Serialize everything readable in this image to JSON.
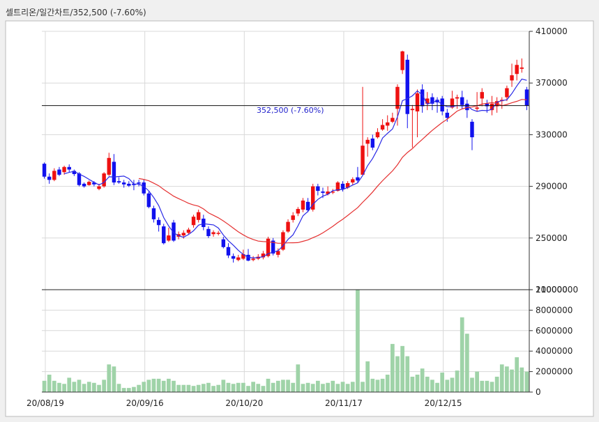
{
  "header": {
    "title": "셀트리온/일간차트/352,500  (-7.60%)"
  },
  "colors": {
    "up": "#ee1111",
    "down": "#1111ee",
    "ma_short": "#2a2ae6",
    "ma_long": "#e53030",
    "volume": "#9fd3a8",
    "grid": "#d8d8d8",
    "bg": "#ffffff"
  },
  "chart_data": [
    {
      "type": "candlestick",
      "title": "셀트리온/일간차트/352,500  (-7.60%)",
      "current_label": "352,500 (-7.60%)",
      "current_price": 352500,
      "ylim": [
        210000,
        410000
      ],
      "y_ticks": [
        "410000",
        "370000",
        "330000",
        "290000",
        "250000",
        "210000"
      ],
      "y_tick_values": [
        410000,
        370000,
        330000,
        290000,
        250000,
        210000
      ],
      "x_ticks": [
        "20/08/19",
        "20/09/16",
        "20/10/20",
        "20/11/17",
        "20/12/15"
      ],
      "x_tick_index": [
        0,
        20,
        40,
        60,
        80
      ],
      "grid": true,
      "candles": [
        [
          307500,
          297500,
          308500,
          296000
        ],
        [
          297500,
          295000,
          300000,
          292000
        ],
        [
          295000,
          302000,
          304000,
          294000
        ],
        [
          303000,
          299000,
          305000,
          298000
        ],
        [
          301000,
          305000,
          306000,
          299000
        ],
        [
          305000,
          303000,
          307000,
          301000
        ],
        [
          302000,
          299500,
          303000,
          298000
        ],
        [
          300000,
          291000,
          301000,
          290000
        ],
        [
          292000,
          290000,
          293000,
          289000
        ],
        [
          291000,
          293500,
          294500,
          290500
        ],
        [
          293000,
          291500,
          294000,
          290000
        ],
        [
          288000,
          290000,
          292000,
          287000
        ],
        [
          290000,
          300000,
          301000,
          289000
        ],
        [
          299000,
          312000,
          316000,
          298000
        ],
        [
          309000,
          293000,
          315000,
          291000
        ],
        [
          294000,
          293000,
          297000,
          292000
        ],
        [
          293000,
          291500,
          295000,
          289000
        ],
        [
          292000,
          290500,
          294000,
          289500
        ],
        [
          292000,
          291000,
          295000,
          287000
        ],
        [
          293000,
          292500,
          295000,
          290000
        ],
        [
          293000,
          284500,
          295000,
          283000
        ],
        [
          284500,
          274000,
          286000,
          273000
        ],
        [
          273000,
          264500,
          275000,
          262000
        ],
        [
          264000,
          260000,
          266000,
          255000
        ],
        [
          259000,
          246000,
          261000,
          245000
        ],
        [
          248000,
          252000,
          258000,
          247000
        ],
        [
          262000,
          248000,
          264000,
          247000
        ],
        [
          251000,
          253000,
          255000,
          249000
        ],
        [
          252000,
          254000,
          256000,
          249500
        ],
        [
          254000,
          256500,
          258000,
          253000
        ],
        [
          260000,
          266500,
          268000,
          258000
        ],
        [
          264000,
          270000,
          272000,
          262000
        ],
        [
          265000,
          258500,
          268000,
          256000
        ],
        [
          257000,
          251500,
          259000,
          250000
        ],
        [
          253000,
          254500,
          256000,
          251000
        ],
        [
          254000,
          254000,
          255500,
          252000
        ],
        [
          249000,
          243000,
          251000,
          242000
        ],
        [
          243000,
          236500,
          246000,
          234500
        ],
        [
          236000,
          234000,
          238000,
          231000
        ],
        [
          233000,
          235000,
          237000,
          232000
        ],
        [
          234000,
          237500,
          241000,
          233000
        ],
        [
          237000,
          232500,
          241500,
          232000
        ],
        [
          233000,
          234000,
          236000,
          232000
        ],
        [
          234000,
          235500,
          237500,
          233000
        ],
        [
          235000,
          238000,
          240000,
          233500
        ],
        [
          236000,
          249500,
          251000,
          235000
        ],
        [
          248000,
          238000,
          250000,
          236500
        ],
        [
          237000,
          240000,
          242000,
          235000
        ],
        [
          241000,
          254500,
          256000,
          240000
        ],
        [
          255000,
          262500,
          264500,
          254000
        ],
        [
          264000,
          267500,
          270000,
          262000
        ],
        [
          269000,
          272500,
          274000,
          267000
        ],
        [
          272000,
          279000,
          281000,
          270000
        ],
        [
          278000,
          271500,
          281000,
          270000
        ],
        [
          272000,
          290000,
          292000,
          270500
        ],
        [
          290000,
          286500,
          292000,
          283000
        ],
        [
          286000,
          285000,
          289000,
          281000
        ],
        [
          284000,
          286000,
          290000,
          283000
        ],
        [
          286000,
          286000,
          288000,
          284000
        ],
        [
          286500,
          293000,
          294000,
          286000
        ],
        [
          292000,
          288000,
          294000,
          286000
        ],
        [
          289000,
          292500,
          294000,
          288000
        ],
        [
          293000,
          295500,
          297000,
          291000
        ],
        [
          297000,
          294500,
          305000,
          293000
        ],
        [
          299000,
          321500,
          367000,
          299000
        ],
        [
          323000,
          326000,
          328000,
          313000
        ],
        [
          327000,
          320000,
          330000,
          318000
        ],
        [
          328000,
          332000,
          335000,
          327000
        ],
        [
          334000,
          337500,
          342000,
          333000
        ],
        [
          337000,
          339500,
          345000,
          333000
        ],
        [
          340000,
          343000,
          347000,
          339000
        ],
        [
          350000,
          367000,
          369000,
          337000
        ],
        [
          380000,
          394500,
          395000,
          377000
        ],
        [
          388000,
          346000,
          392000,
          335000
        ],
        [
          349000,
          350000,
          353000,
          320000
        ],
        [
          348000,
          362000,
          365000,
          328000
        ],
        [
          365000,
          352000,
          369000,
          347000
        ],
        [
          354000,
          358000,
          363000,
          349000
        ],
        [
          359000,
          354000,
          362000,
          349000
        ],
        [
          357000,
          355000,
          359000,
          347000
        ],
        [
          358000,
          348000,
          360000,
          345000
        ],
        [
          347000,
          343000,
          350000,
          340000
        ],
        [
          351000,
          358000,
          364000,
          350000
        ],
        [
          358000,
          359000,
          361000,
          350000
        ],
        [
          359000,
          353000,
          364000,
          350000
        ],
        [
          354000,
          349000,
          357000,
          343000
        ],
        [
          340000,
          328000,
          342000,
          318000
        ],
        [
          350000,
          351000,
          363000,
          348000
        ],
        [
          358000,
          363000,
          366000,
          352000
        ],
        [
          354000,
          352000,
          357000,
          347000
        ],
        [
          349000,
          354000,
          360000,
          345000
        ],
        [
          352000,
          356000,
          359000,
          347000
        ],
        [
          356000,
          357000,
          359000,
          350000
        ],
        [
          359000,
          366000,
          368000,
          356000
        ],
        [
          372000,
          376000,
          385000,
          367000
        ],
        [
          377000,
          384000,
          388000,
          372000
        ],
        [
          381000,
          382000,
          389000,
          378000
        ],
        [
          365000,
          352500,
          367000,
          349000
        ]
      ],
      "volume": {
        "ylim": [
          0,
          10000000
        ],
        "y_ticks": [
          "10000000",
          "8000000",
          "6000000",
          "4000000",
          "2000000",
          "0"
        ],
        "y_tick_values": [
          10000000,
          8000000,
          6000000,
          4000000,
          2000000,
          0
        ],
        "values": [
          1100000,
          1700000,
          1100000,
          900000,
          800000,
          1400000,
          1000000,
          1200000,
          800000,
          1000000,
          900000,
          700000,
          1200000,
          2700000,
          2500000,
          800000,
          400000,
          400000,
          500000,
          700000,
          1000000,
          1200000,
          1300000,
          1300000,
          1100000,
          1300000,
          1100000,
          700000,
          700000,
          700000,
          600000,
          700000,
          800000,
          900000,
          600000,
          700000,
          1200000,
          900000,
          800000,
          900000,
          900000,
          600000,
          1000000,
          800000,
          600000,
          1300000,
          900000,
          1100000,
          1200000,
          1200000,
          900000,
          2700000,
          800000,
          900000,
          800000,
          1100000,
          800000,
          900000,
          1100000,
          800000,
          1000000,
          800000,
          1000000,
          10000000,
          1000000,
          3000000,
          1300000,
          1200000,
          1300000,
          1700000,
          4700000,
          3500000,
          4500000,
          3500000,
          1500000,
          1700000,
          2300000,
          1500000,
          1200000,
          900000,
          1900000,
          1200000,
          1400000,
          2100000,
          7300000,
          5700000,
          1400000,
          2000000,
          1100000,
          1100000,
          1000000,
          1500000,
          2700000,
          2500000,
          2200000,
          3400000,
          2400000,
          2000000
        ]
      }
    }
  ]
}
